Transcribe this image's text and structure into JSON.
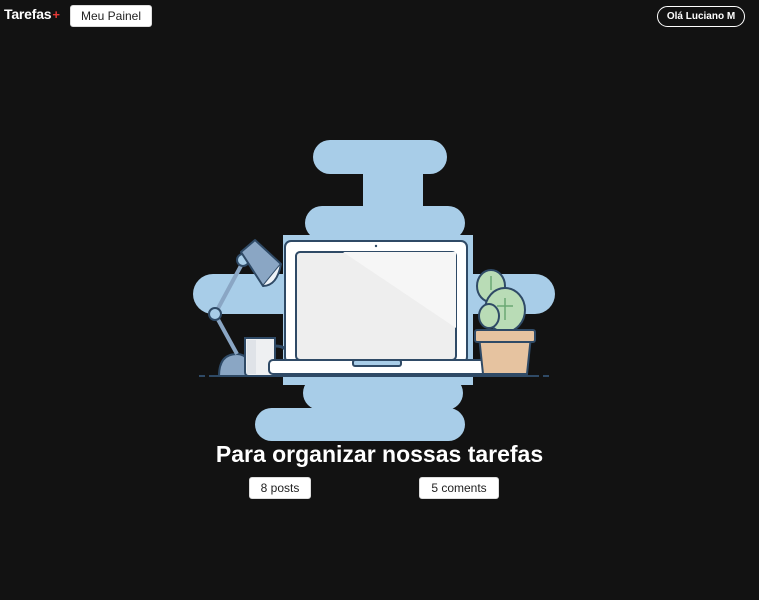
{
  "header": {
    "brand": "Tarefas",
    "brand_mark": "+",
    "panel_button": "Meu Painel",
    "user_greeting": "Olá Luciano M"
  },
  "hero": {
    "illustration": "laptop-desk-illustration",
    "headline": "Para organizar nossas tarefas",
    "posts_label": "8 posts",
    "comments_label": "5 coments"
  },
  "colors": {
    "background": "#121212",
    "brand_accent": "#e53935",
    "cloud": "#a8cde8",
    "outline": "#2f4a66"
  }
}
